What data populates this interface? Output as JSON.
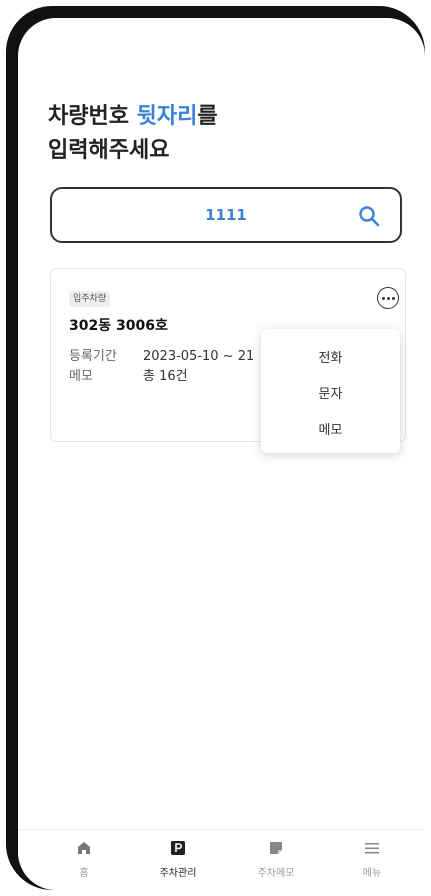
{
  "headline": {
    "line1_prefix": "차량번호 ",
    "line1_accent": "뒷자리",
    "line1_suffix": "를",
    "line2": "입력해주세요"
  },
  "search": {
    "value": "1111"
  },
  "result": {
    "badge": "입주차량",
    "unit": "302동 3006호",
    "period_label": "등록기간",
    "period_value": "2023-05-10 ~ 21",
    "memo_label": "메모",
    "memo_value": "총 16건"
  },
  "menu": {
    "items": [
      "전화",
      "문자",
      "메모"
    ]
  },
  "tabs": [
    {
      "label": "홈",
      "icon": "home-icon"
    },
    {
      "label": "주차관리",
      "icon": "parking-icon"
    },
    {
      "label": "주차메모",
      "icon": "note-icon"
    },
    {
      "label": "메뉴",
      "icon": "hamburger-menu-icon"
    }
  ],
  "colors": {
    "accent": "#3a83d6",
    "frame": "#111111",
    "text": "#222222"
  }
}
